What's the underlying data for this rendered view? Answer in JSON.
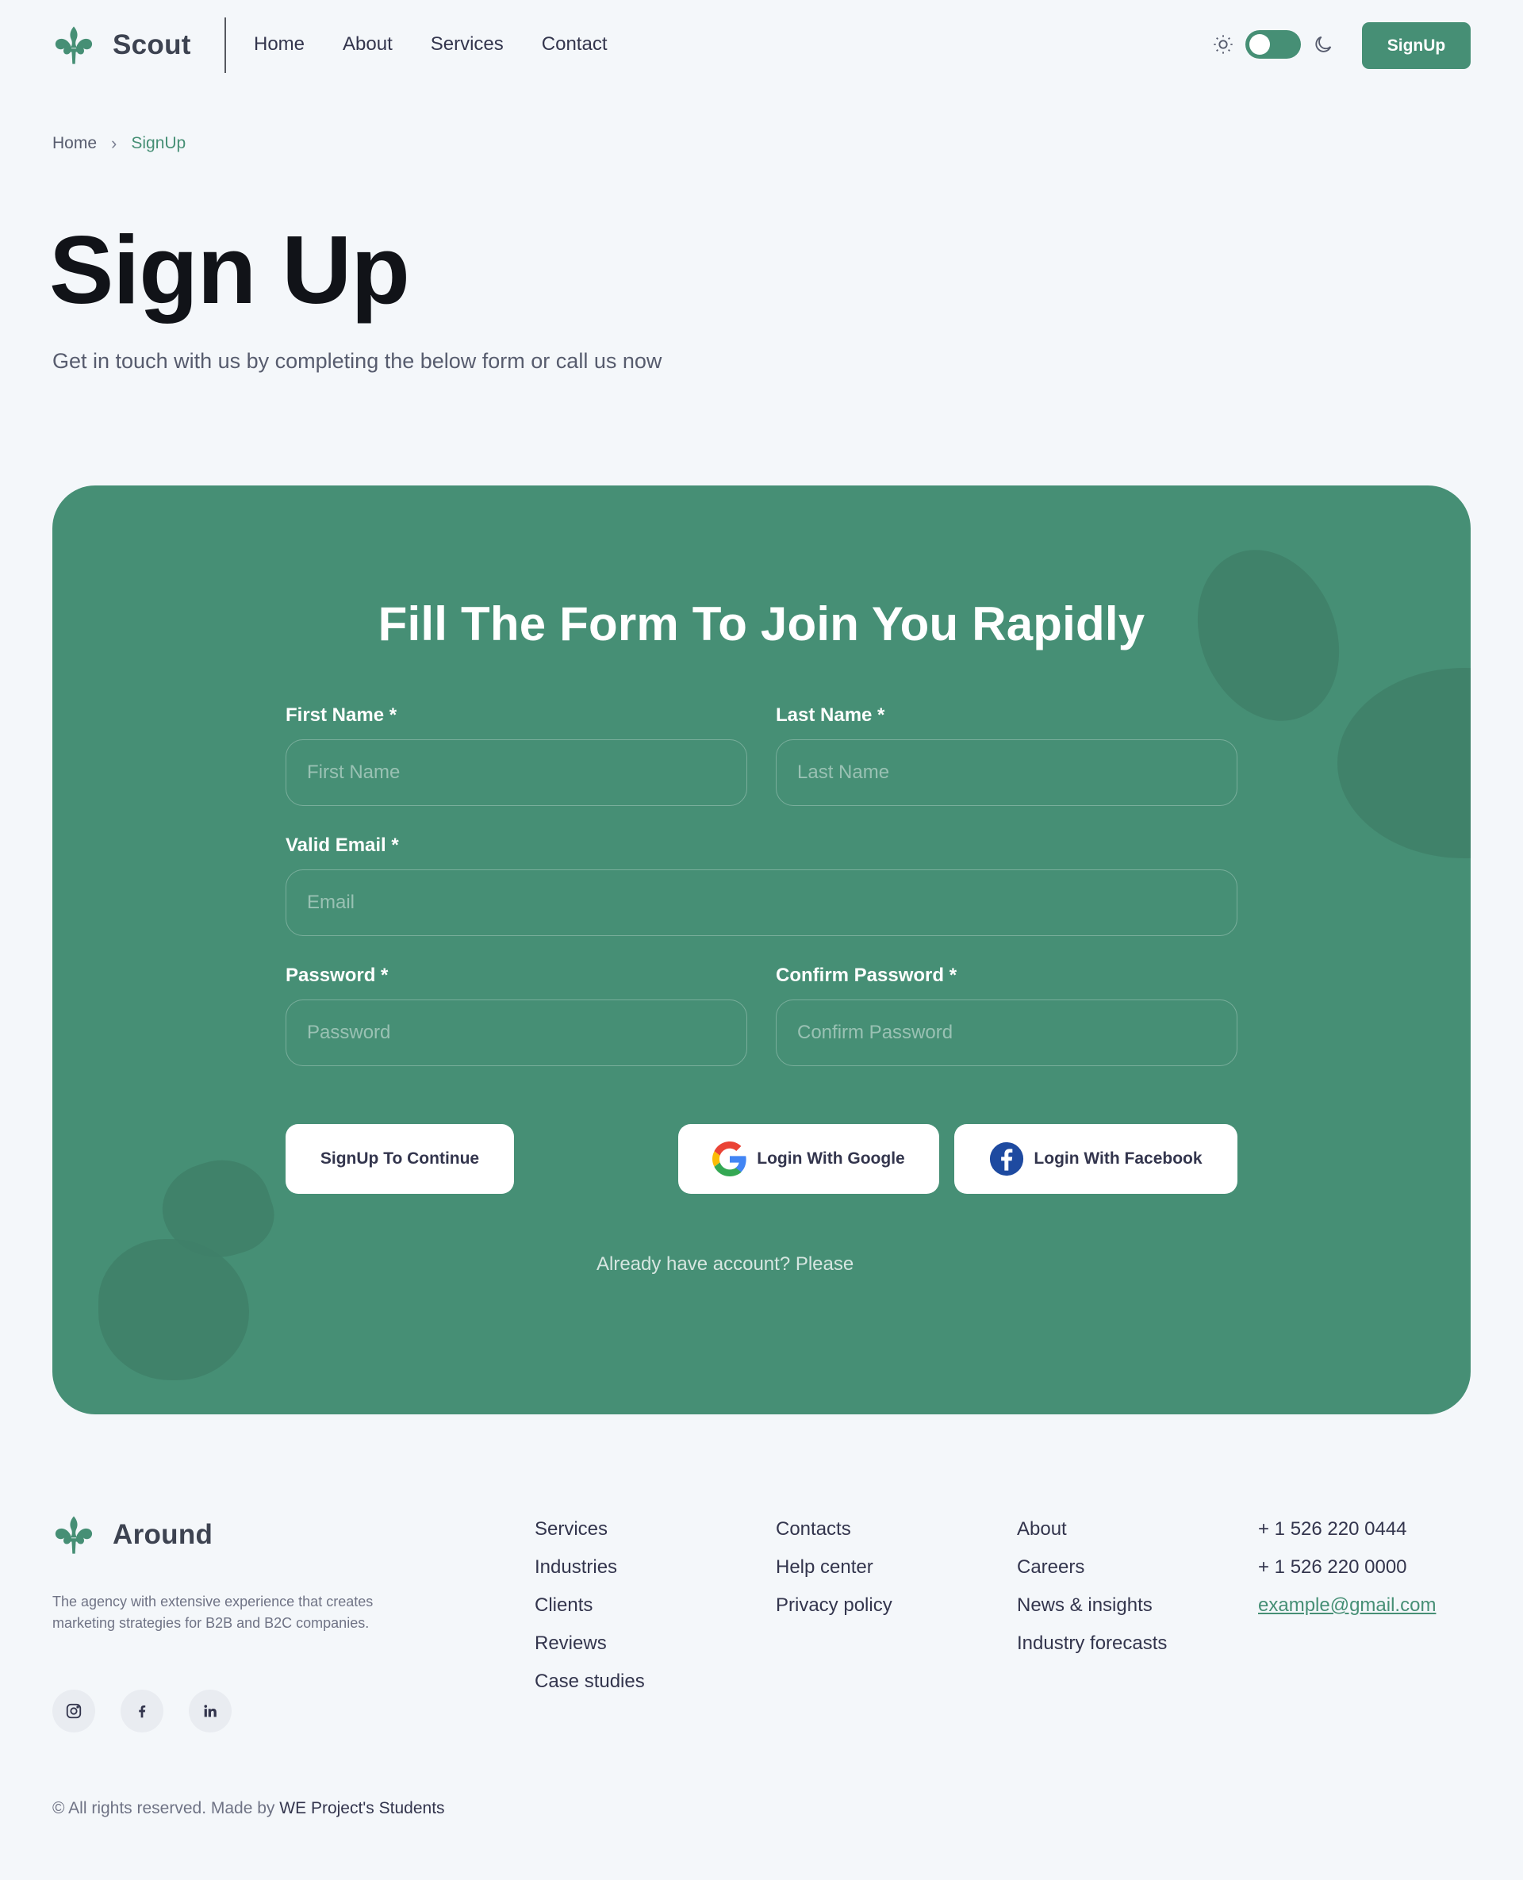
{
  "header": {
    "brand": "Scout",
    "nav": [
      "Home",
      "About",
      "Services",
      "Contact"
    ],
    "signup_label": "SignUp",
    "theme_toggle": {
      "state": "light",
      "icons": [
        "sun-icon",
        "moon-icon"
      ]
    }
  },
  "breadcrumb": {
    "home": "Home",
    "separator": "›",
    "current": "SignUp"
  },
  "page": {
    "title": "Sign Up",
    "subtitle": "Get in touch with us by completing the below form or call us now"
  },
  "form": {
    "title": "Fill The Form To Join You Rapidly",
    "first_name": {
      "label": "First Name *",
      "placeholder": "First Name"
    },
    "last_name": {
      "label": "Last Name *",
      "placeholder": "Last Name"
    },
    "email": {
      "label": "Valid Email *",
      "placeholder": "Email"
    },
    "password": {
      "label": "Password *",
      "placeholder": "Password"
    },
    "confirm_password": {
      "label": "Confirm Password *",
      "placeholder": "Confirm Password"
    },
    "submit_label": "SignUp To Continue",
    "google_label": "Login With Google",
    "facebook_label": "Login With Facebook",
    "already_text": "Already have account? Please"
  },
  "footer": {
    "brand": "Around",
    "description": "The agency with extensive experience that creates marketing strategies for B2B and B2C companies.",
    "socials": [
      "instagram-icon",
      "facebook-icon",
      "linkedin-icon"
    ],
    "col1": [
      "Services",
      "Industries",
      "Clients",
      "Reviews",
      "Case studies"
    ],
    "col2": [
      "Contacts",
      "Help center",
      "Privacy policy"
    ],
    "col3": [
      "About",
      "Careers",
      "News & insights",
      "Industry forecasts"
    ],
    "contact": {
      "phone1": "+ 1 526 220 0444",
      "phone2": "+ 1 526 220 0000",
      "email": "example@gmail.com"
    },
    "copyright_prefix": "© All rights reserved. Made by",
    "copyright_name": "WE Project's Students"
  },
  "colors": {
    "accent": "#468f75",
    "background": "#f4f7fa",
    "text": "#33354d"
  }
}
